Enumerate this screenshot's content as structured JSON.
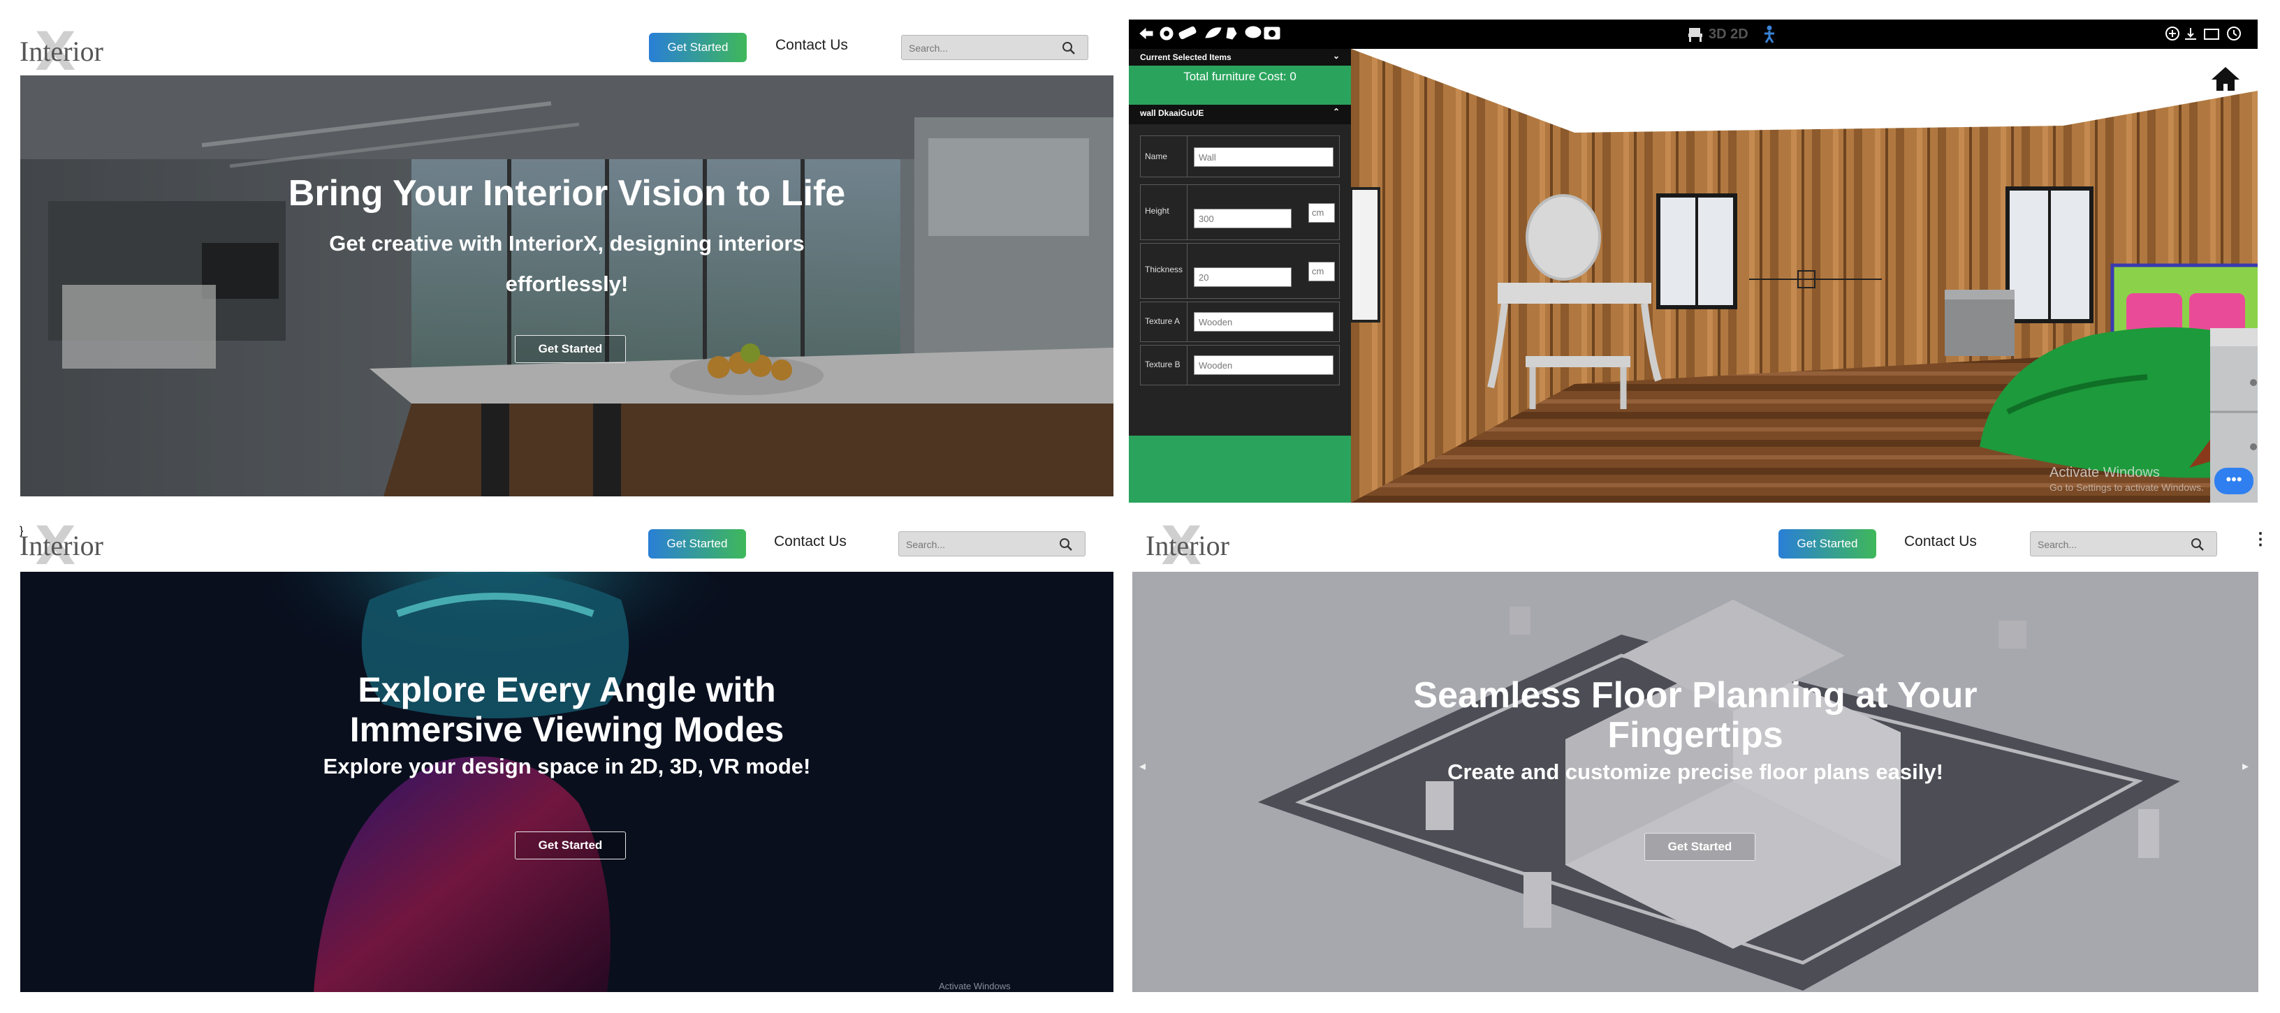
{
  "navbar": {
    "logo_text": "Interior",
    "logo_mark": "X",
    "get_started_label": "Get Started",
    "contact_label": "Contact Us",
    "search_placeholder": "Search..."
  },
  "slide1": {
    "title": "Bring Your Interior Vision to Life",
    "subtitle_line1": "Get creative with InteriorX, designing interiors",
    "subtitle_line2": "effortlessly!",
    "cta": "Get Started"
  },
  "slide2": {
    "title_line1": "Explore Every Angle with",
    "title_line2": "Immersive Viewing Modes",
    "subtitle": "Explore your design space in 2D, 3D, VR mode!",
    "cta": "Get Started"
  },
  "slide3": {
    "title_line1": "Seamless Floor Planning at Your",
    "title_line2": "Fingertips",
    "subtitle": "Create and customize precise floor plans easily!",
    "cta": "Get Started",
    "prev_arrow": "◂",
    "next_arrow": "▸",
    "more_icon": "⋮"
  },
  "editor": {
    "view_modes": "3D 2D",
    "current_items_header": "Current Selected Items",
    "furniture_cost": "Total furniture Cost: 0",
    "wall_header": "wall DkaaiGuUE",
    "fields": {
      "name_label": "Name",
      "name_value": "Wall",
      "height_label": "Height",
      "height_value": "300",
      "height_unit": "cm",
      "thickness_label": "Thickness",
      "thickness_value": "20",
      "thickness_unit": "cm",
      "texture_a_label": "Texture A",
      "texture_a_value": "Wooden",
      "texture_b_label": "Texture B",
      "texture_b_value": "Wooden"
    },
    "activate_line1": "Activate Windows",
    "activate_line2": "Go to Settings to activate Windows.",
    "chat_dots": "•••"
  },
  "watermark_bottom": "Activate Windows",
  "colors": {
    "accent_blue": "#2a7fd6",
    "accent_green": "#3fb85a",
    "sidebar_green": "#2aa45d"
  }
}
